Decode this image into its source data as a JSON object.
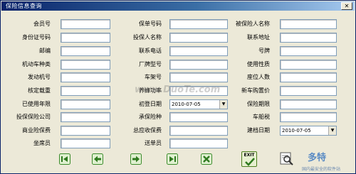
{
  "window": {
    "title": "保险信息查询"
  },
  "fields": {
    "col1": [
      "会员号",
      "身份证号码",
      "邮编",
      "机动车种类",
      "发动机号",
      "核定载重",
      "已使用年限",
      "投保保险公司",
      "商业险保费",
      "坐席员"
    ],
    "col2": [
      "保单号码",
      "投保人名称",
      "联系电话",
      "厂牌型号",
      "车架号",
      "养蜂功率",
      "初登日期",
      "承保险种",
      "总应收保费",
      "送单员"
    ],
    "col3": [
      "被保险人名称",
      "联系地址",
      "号牌",
      "使用性质",
      "座位人数",
      "新车购置价",
      "保险期限",
      "车船税",
      "建档日期"
    ]
  },
  "dates": {
    "first_reg": "2010-07-05",
    "created": "2010-07-05"
  },
  "toolbar": {
    "first": "first-record-icon",
    "prev": "previous-record-icon",
    "next": "next-record-icon",
    "last": "last-record-icon",
    "delete": "delete-icon",
    "exit_label": "EXIT",
    "print": "print-preview-icon"
  },
  "watermark": {
    "site": "www.DuoTe.com",
    "logo_big": "多特",
    "logo_small": "国内最安全的软件站"
  }
}
